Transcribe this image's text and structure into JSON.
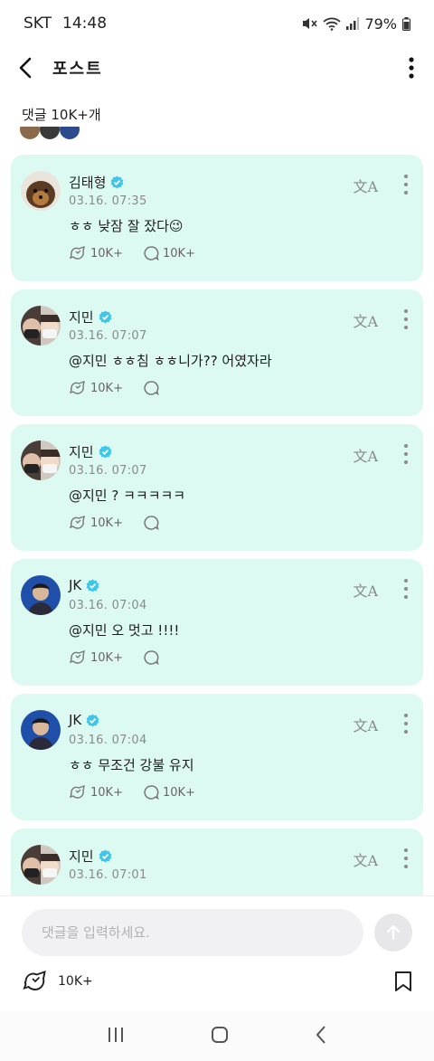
{
  "status": {
    "carrier": "SKT",
    "time": "14:48",
    "battery": "79%"
  },
  "header": {
    "title": "포스트"
  },
  "comments_count": "댓글 10K+개",
  "comments": [
    {
      "name": "김태형",
      "date": "03.16. 07:35",
      "text": "ㅎㅎ 낮잠 잘 잤다😉",
      "likes": "10K+",
      "replies": "10K+",
      "avatar": "dog"
    },
    {
      "name": "지민",
      "date": "03.16. 07:07",
      "text": "@지민 ㅎㅎ침 ㅎㅎ니가?? 어였자라",
      "likes": "10K+",
      "replies": "",
      "avatar": "jimin"
    },
    {
      "name": "지민",
      "date": "03.16. 07:07",
      "text": "@지민 ? ㅋㅋㅋㅋㅋ",
      "likes": "10K+",
      "replies": "",
      "avatar": "jimin"
    },
    {
      "name": "JK",
      "date": "03.16. 07:04",
      "text": "@지민 오 멋고 !!!!",
      "likes": "10K+",
      "replies": "",
      "avatar": "jk"
    },
    {
      "name": "JK",
      "date": "03.16. 07:04",
      "text": "ㅎㅎ 무조건 강불 유지",
      "likes": "10K+",
      "replies": "10K+",
      "avatar": "jk"
    },
    {
      "name": "지민",
      "date": "03.16. 07:01",
      "text": "",
      "likes": "",
      "replies": "",
      "avatar": "jimin"
    }
  ],
  "icons": {
    "translate": "文A"
  },
  "compose": {
    "placeholder": "댓글을 입력하세요.",
    "post_likes": "10K+"
  },
  "colors": {
    "card_bg": "#ddfaf2",
    "verified": "#3fc6e8"
  }
}
